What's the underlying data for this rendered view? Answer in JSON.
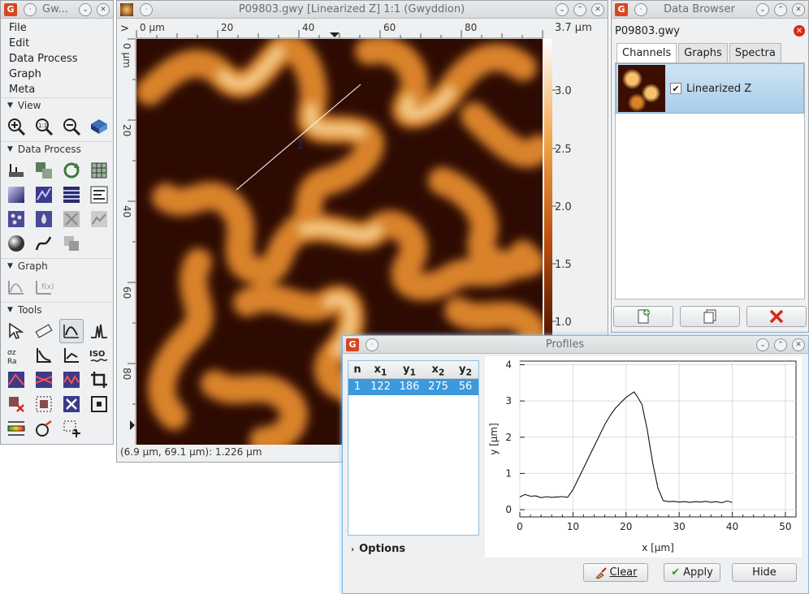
{
  "toolbox": {
    "title": "Gw...",
    "menu": [
      "File",
      "Edit",
      "Data Process",
      "Graph",
      "Meta"
    ],
    "sections": {
      "view": "View",
      "data_process": "Data Process",
      "graph": "Graph",
      "tools": "Tools"
    }
  },
  "image_window": {
    "title": "P09803.gwy [Linearized Z] 1:1 (Gwyddion)",
    "x_axis_ticks": [
      "0 µm",
      "20",
      "40",
      "60",
      "80"
    ],
    "y_axis_ticks": [
      "0 µm",
      "20",
      "40",
      "60",
      "80"
    ],
    "colorbar_labels": [
      "3.7 µm",
      "3.0",
      "2.5",
      "2.0",
      "1.5",
      "1.0"
    ],
    "profile_label": "1",
    "status": "(6.9 µm, 69.1 µm): 1.226 µm",
    "ruler_corner": ">"
  },
  "data_browser": {
    "title": "Data Browser",
    "file_name": "P09803.gwy",
    "tabs": [
      "Channels",
      "Graphs",
      "Spectra"
    ],
    "channel_name": "Linearized Z"
  },
  "profiles": {
    "title": "Profiles",
    "columns": [
      "n",
      "x",
      "y",
      "x",
      "y"
    ],
    "column_subscripts": [
      "",
      "1",
      "1",
      "2",
      "2"
    ],
    "rows": [
      [
        "1",
        "122",
        "186",
        "275",
        "56"
      ]
    ],
    "options_label": "Options",
    "buttons": {
      "clear": "Clear",
      "apply": "Apply",
      "hide": "Hide"
    }
  },
  "chart_data": {
    "type": "line",
    "xlabel": "x [µm]",
    "ylabel": "y [µm]",
    "xlim": [
      0,
      52
    ],
    "ylim": [
      -0.2,
      4.1
    ],
    "x_ticks": [
      "0",
      "10",
      "20",
      "30",
      "40",
      "50"
    ],
    "y_ticks": [
      "0",
      "1",
      "2",
      "3",
      "4"
    ],
    "x": [
      0,
      1,
      2,
      3,
      4,
      5,
      6,
      7,
      8,
      9,
      10,
      11,
      12,
      13,
      14,
      15,
      16,
      17,
      18,
      19,
      20,
      21,
      21.5,
      22,
      23,
      24,
      25,
      26,
      27,
      28,
      29,
      30,
      31,
      32,
      33,
      34,
      35,
      36,
      37,
      38,
      39,
      40
    ],
    "values": [
      0.35,
      0.42,
      0.37,
      0.38,
      0.33,
      0.36,
      0.34,
      0.35,
      0.36,
      0.34,
      0.55,
      0.85,
      1.15,
      1.45,
      1.75,
      2.05,
      2.35,
      2.6,
      2.8,
      2.95,
      3.1,
      3.2,
      3.25,
      3.15,
      2.9,
      2.2,
      1.3,
      0.6,
      0.25,
      0.22,
      0.23,
      0.21,
      0.22,
      0.2,
      0.22,
      0.21,
      0.23,
      0.2,
      0.22,
      0.19,
      0.24,
      0.2
    ]
  }
}
